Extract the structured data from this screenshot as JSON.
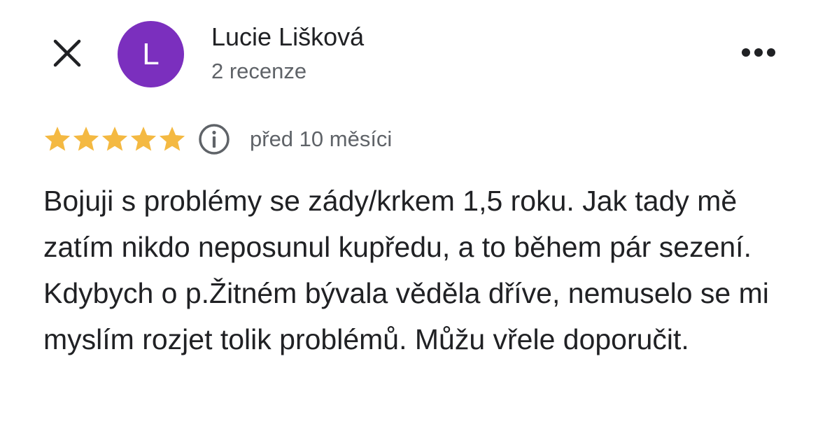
{
  "header": {
    "close_icon": "close-icon",
    "more_icon": "more-horizontal-icon"
  },
  "author": {
    "initial": "L",
    "name": "Lucie Lišková",
    "review_count": "2 recenze",
    "avatar_color": "#7B2FBE"
  },
  "review": {
    "rating": 5,
    "rating_max": 5,
    "star_color": "#F4B942",
    "info_icon": "info-icon",
    "date": "před 10 měsíci",
    "text": "Bojuji s problémy se zády/krkem 1,5 roku. Jak tady mě zatím nikdo neposunul kupředu, a to během pár sezení. Kdybych o p.Žitném bývala věděla dříve, nemuselo se mi myslím rozjet tolik problémů. Můžu vřele doporučit."
  }
}
